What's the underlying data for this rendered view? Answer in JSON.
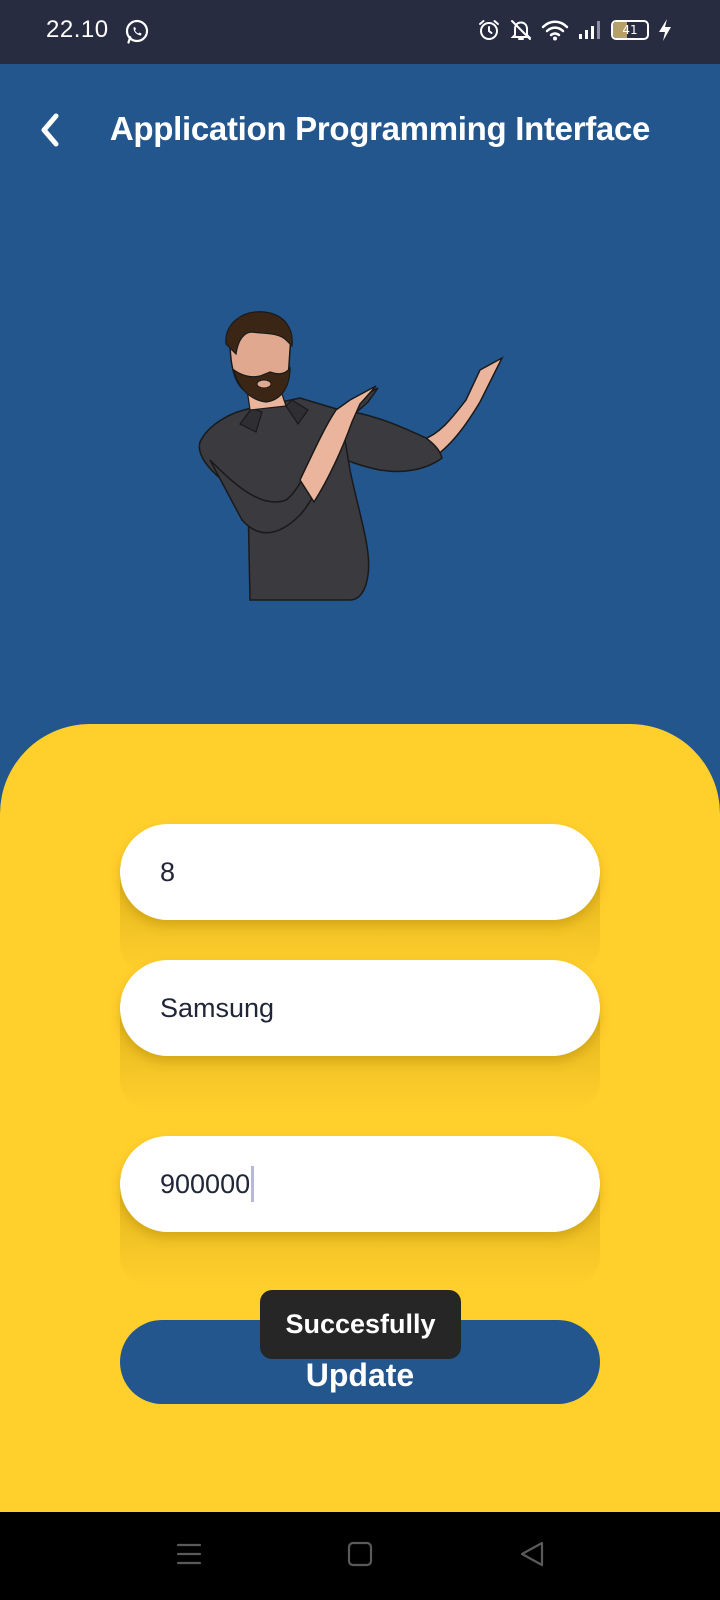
{
  "status_bar": {
    "time": "22.10",
    "battery_level": "41",
    "battery_fraction": 0.41,
    "icons": [
      "whatsapp-icon",
      "alarm-icon",
      "notifications-off-icon",
      "wifi-icon",
      "signal-icon",
      "battery-icon",
      "charging-icon"
    ]
  },
  "header": {
    "title": "Application Programming Interface",
    "back_icon": "chevron-left-icon"
  },
  "illustration": {
    "icon": "man-pointing-illustration"
  },
  "form": {
    "fields": [
      {
        "value": "8"
      },
      {
        "value": "Samsung"
      },
      {
        "value": "900000"
      }
    ],
    "update_label": "Update"
  },
  "toast": {
    "message": "Succesfully"
  },
  "nav_bar": {
    "icons": [
      "menu-icon",
      "home-icon",
      "back-triangle-icon"
    ]
  },
  "colors": {
    "background": "#23568D",
    "status_bar": "#282C40",
    "panel": "#FFCF2C",
    "field": "#FFFFFF",
    "button": "#23568D",
    "toast": "#262626"
  }
}
